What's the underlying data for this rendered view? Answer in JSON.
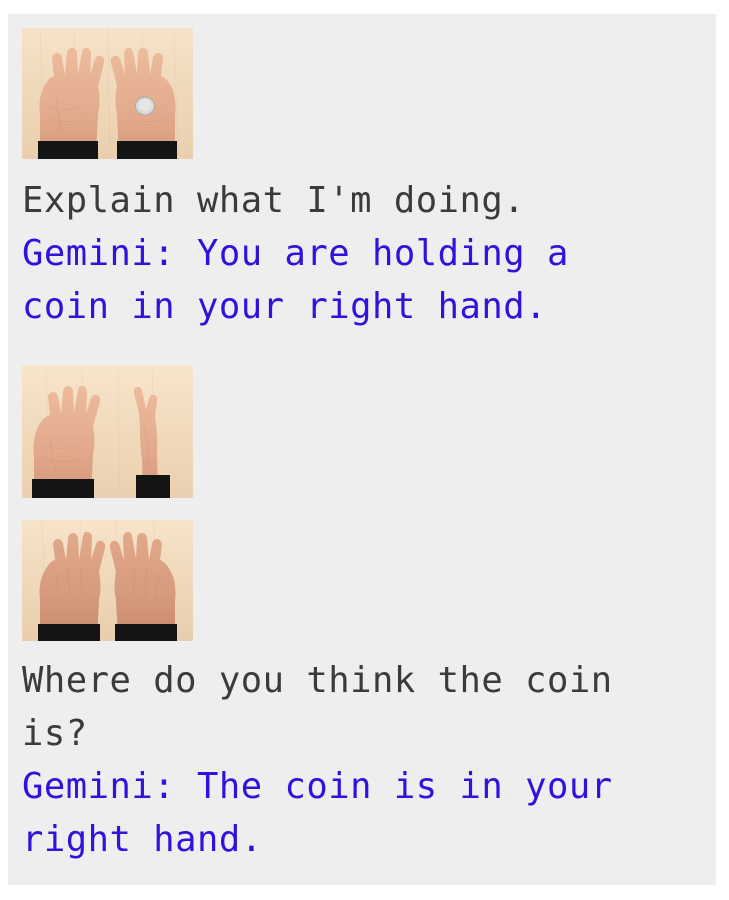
{
  "conversation": {
    "turns": [
      {
        "image": {
          "name": "hands-open-palms-with-coin",
          "alt": "Two open palms facing up on a light wood table, a silver coin resting in the right palm"
        },
        "lines": [
          {
            "speaker": "user",
            "text": "Explain what I'm doing."
          },
          {
            "speaker": "gemini",
            "text": "Gemini: You are holding a"
          },
          {
            "speaker": "gemini",
            "text": "coin in your right hand."
          }
        ]
      },
      {
        "images": [
          {
            "name": "left-palm-open-right-hand-turned",
            "alt": "Left palm open facing up, right hand turned edge-on, on a light wood table"
          },
          {
            "name": "both-hands-palms-down",
            "alt": "Both hands palms down on a light wood table, backs of hands visible"
          }
        ],
        "lines": [
          {
            "speaker": "user",
            "text": "Where do you think the coin"
          },
          {
            "speaker": "user",
            "text": "is?"
          },
          {
            "speaker": "gemini",
            "text": "Gemini: The coin is in your"
          },
          {
            "speaker": "gemini",
            "text": "right hand."
          }
        ]
      }
    ]
  },
  "colors": {
    "page_background": "#ffffff",
    "panel_background": "#eeeeee",
    "user_text": "#3b3b3b",
    "gemini_text": "#3311dd",
    "wood_table": "#f0dcc0",
    "skin": "#e8b596",
    "sleeve": "#141414",
    "coin": "#d6d6d6"
  }
}
